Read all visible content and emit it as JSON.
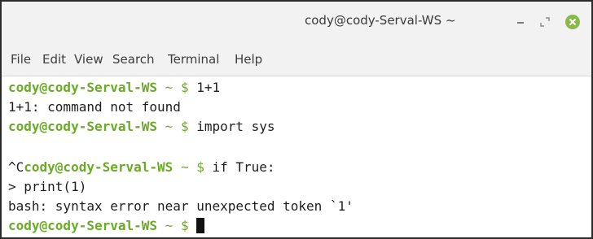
{
  "window": {
    "title": "cody@cody-Serval-WS ~",
    "buttons": {
      "minimize": "−",
      "maximize": "⤢",
      "close": "×"
    }
  },
  "menu": [
    "File",
    "Edit",
    "View",
    "Search",
    "Terminal",
    "Help"
  ],
  "prompt": {
    "user": "cody@cody-Serval-WS",
    "path": "~",
    "symbol": "$"
  },
  "terminal": {
    "lines": [
      {
        "prefix": "",
        "prompt": true,
        "command": "1+1"
      },
      {
        "output": "1+1: command not found"
      },
      {
        "prefix": "",
        "prompt": true,
        "command": "import sys"
      },
      {
        "output": ""
      },
      {
        "prefix": "^C",
        "prompt": true,
        "command": "if True:"
      },
      {
        "output": "> print(1)"
      },
      {
        "output": "bash: syntax error near unexpected token `1'"
      },
      {
        "prefix": "",
        "prompt": true,
        "command": "",
        "cursor": true
      }
    ]
  },
  "colors": {
    "prompt_green": "#6aab25",
    "close_button": "#8bb84b",
    "text": "#1e1e1e"
  }
}
